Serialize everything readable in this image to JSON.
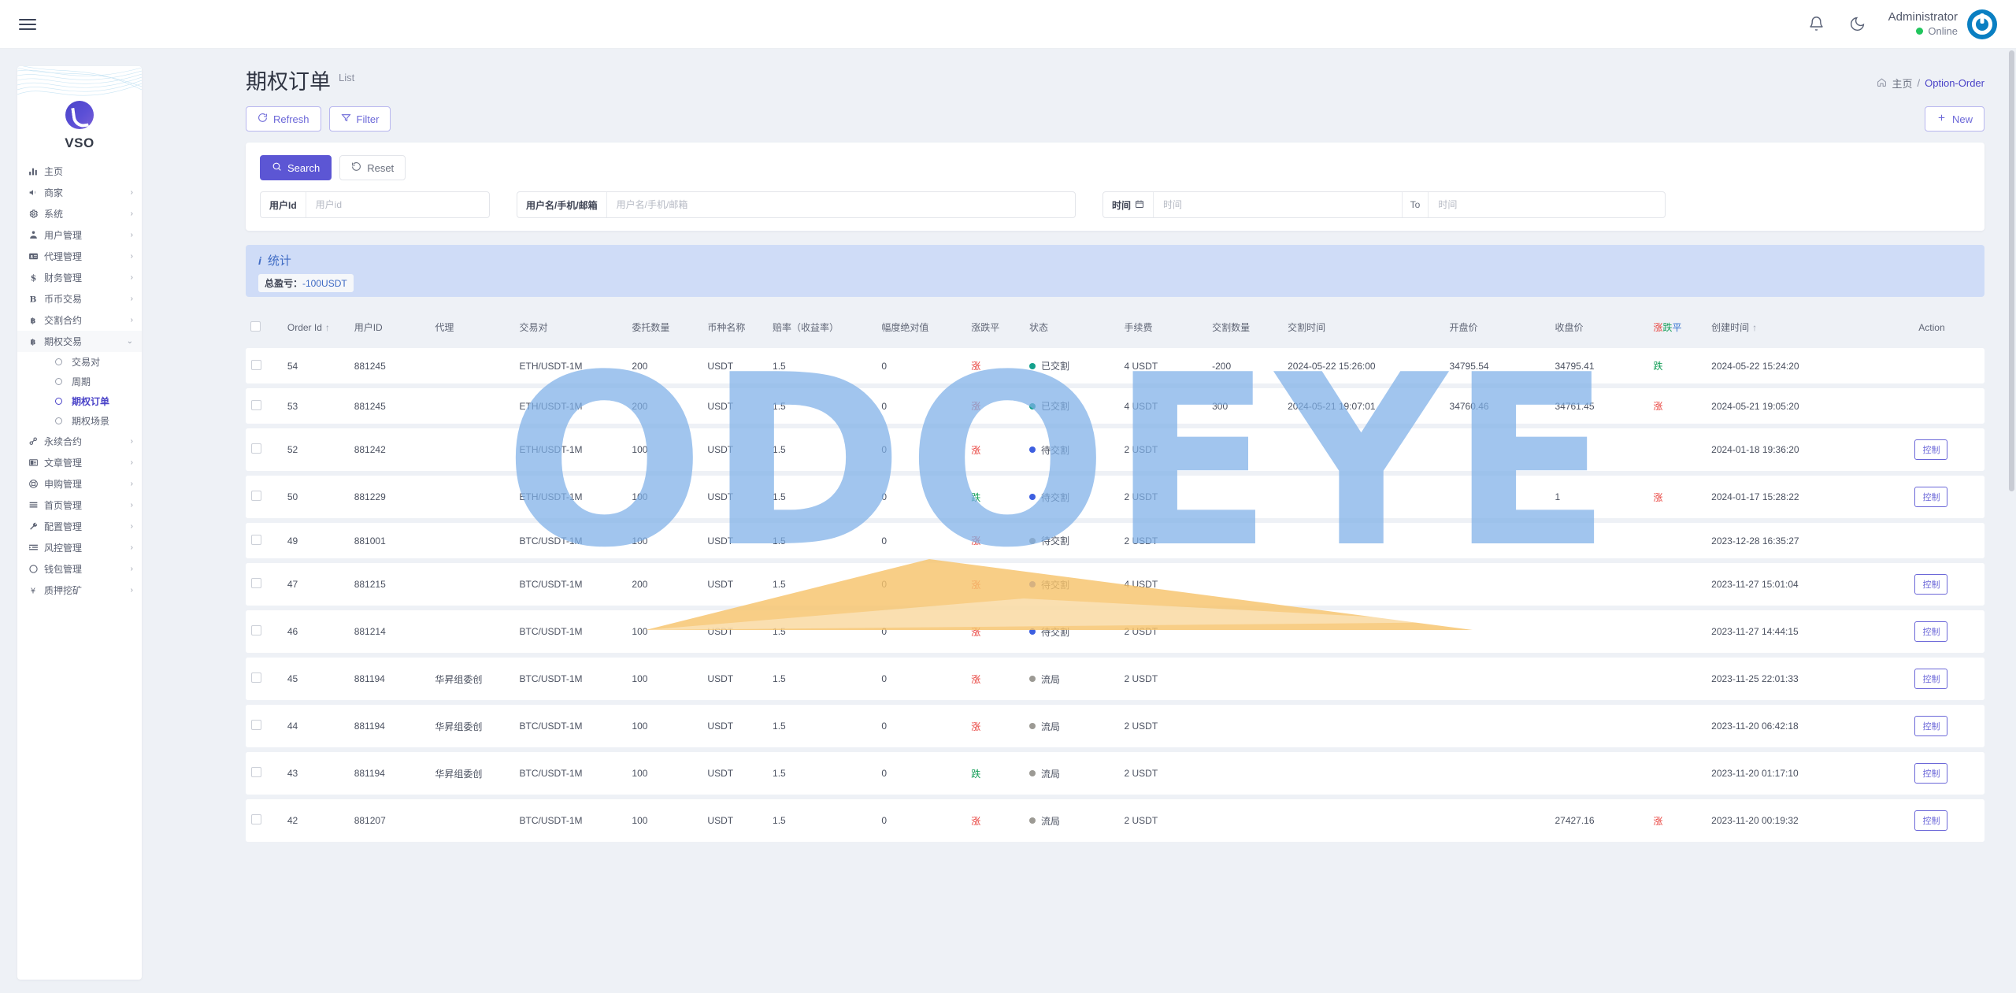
{
  "topbar": {
    "menu_icon": "hamburger-icon",
    "notification_icon": "bell-icon",
    "theme_icon": "moon-icon",
    "user_name": "Administrator",
    "user_status": "Online",
    "avatar_icon": "power-avatar-icon"
  },
  "sidebar": {
    "brand": "VSO",
    "items": [
      {
        "label": "主页",
        "icon": "chart-bars-icon",
        "caret": false
      },
      {
        "label": "商家",
        "icon": "megaphone-icon",
        "caret": true
      },
      {
        "label": "系统",
        "icon": "gear-icon",
        "caret": true
      },
      {
        "label": "用户管理",
        "icon": "user-manage-icon",
        "caret": true
      },
      {
        "label": "代理管理",
        "icon": "id-card-icon",
        "caret": true
      },
      {
        "label": "财务管理",
        "icon": "dollar-icon",
        "caret": true
      },
      {
        "label": "币币交易",
        "icon": "b-letter-icon",
        "caret": true
      },
      {
        "label": "交割合约",
        "icon": "bitcoin-icon",
        "caret": true
      },
      {
        "label": "期权交易",
        "icon": "bitcoin-icon",
        "caret": true,
        "open": true
      },
      {
        "label": "永续合约",
        "icon": "link-icon",
        "caret": true
      },
      {
        "label": "文章管理",
        "icon": "news-icon",
        "caret": true
      },
      {
        "label": "申购管理",
        "icon": "lifebuoy-icon",
        "caret": true
      },
      {
        "label": "首页管理",
        "icon": "lines-icon",
        "caret": true
      },
      {
        "label": "配置管理",
        "icon": "wrench-icon",
        "caret": true
      },
      {
        "label": "风控管理",
        "icon": "indent-icon",
        "caret": true
      },
      {
        "label": "钱包管理",
        "icon": "circle-icon",
        "caret": true
      },
      {
        "label": "质押挖矿",
        "icon": "yen-icon",
        "caret": true
      }
    ],
    "sub_items": [
      {
        "label": "交易对",
        "active": false
      },
      {
        "label": "周期",
        "active": false
      },
      {
        "label": "期权订单",
        "active": true
      },
      {
        "label": "期权场景",
        "active": false
      }
    ]
  },
  "page": {
    "title": "期权订单",
    "subtitle": "List",
    "breadcrumb_home": "主页",
    "breadcrumb_sep": "/",
    "breadcrumb_current": "Option-Order"
  },
  "toolbar": {
    "refresh_label": "Refresh",
    "filter_label": "Filter",
    "new_label": "New",
    "refresh_icon": "refresh-icon",
    "filter_icon": "funnel-icon",
    "new_icon": "plus-icon"
  },
  "search": {
    "search_label": "Search",
    "reset_label": "Reset",
    "search_icon": "search-icon",
    "reset_icon": "undo-icon",
    "userid_label": "用户Id",
    "userid_placeholder": "用户id",
    "userid_value": "",
    "username_label": "用户名/手机/邮箱",
    "username_placeholder": "用户名/手机/邮箱",
    "username_value": "",
    "time_label": "时间",
    "time_icon": "calendar-icon",
    "time_start_placeholder": "时间",
    "time_start_value": "",
    "time_to": "To",
    "time_end_placeholder": "时间",
    "time_end_value": ""
  },
  "stats": {
    "title": "统计",
    "info_icon": "info-icon",
    "chip_label": "总盈亏：",
    "chip_value": "-100USDT"
  },
  "table": {
    "headers": {
      "order_id": "Order Id",
      "user_id": "用户ID",
      "agent": "代理",
      "pair": "交易对",
      "amount": "委托数量",
      "coin": "币种名称",
      "rate": "赔率（收益率）",
      "abs": "幅度绝对值",
      "ud": "涨跌平",
      "status": "状态",
      "fee": "手续费",
      "deliver_qty": "交割数量",
      "deliver_time": "交割时间",
      "open_price": "开盘价",
      "close_price": "收盘价",
      "ud2_up": "涨",
      "ud2_down": "跌",
      "ud2_flat": "平",
      "create_time": "创建时间",
      "action": "Action",
      "sort_icon": "sort-asc-icon"
    },
    "rows": [
      {
        "id": "54",
        "user_id": "881245",
        "agent": "",
        "pair": "ETH/USDT-1M",
        "amount": "200",
        "coin": "USDT",
        "rate": "1.5",
        "abs": "0",
        "ud": "涨",
        "ud_dir": "up",
        "status": "已交割",
        "status_dot": "green",
        "fee": "4 USDT",
        "deliver_qty": "-200",
        "deliver_time": "2024-05-22 15:26:00",
        "open_price": "34795.54",
        "close_price": "34795.41",
        "ud2": "跌",
        "ud2_dir": "down",
        "create_time": "2024-05-22 15:24:20",
        "action": ""
      },
      {
        "id": "53",
        "user_id": "881245",
        "agent": "",
        "pair": "ETH/USDT-1M",
        "amount": "200",
        "coin": "USDT",
        "rate": "1.5",
        "abs": "0",
        "ud": "涨",
        "ud_dir": "up",
        "status": "已交割",
        "status_dot": "green",
        "fee": "4 USDT",
        "deliver_qty": "300",
        "deliver_time": "2024-05-21 19:07:01",
        "open_price": "34760.46",
        "close_price": "34761.45",
        "ud2": "涨",
        "ud2_dir": "up",
        "create_time": "2024-05-21 19:05:20",
        "action": ""
      },
      {
        "id": "52",
        "user_id": "881242",
        "agent": "",
        "pair": "ETH/USDT-1M",
        "amount": "100",
        "coin": "USDT",
        "rate": "1.5",
        "abs": "0",
        "ud": "涨",
        "ud_dir": "up",
        "status": "待交割",
        "status_dot": "blue",
        "fee": "2 USDT",
        "deliver_qty": "",
        "deliver_time": "",
        "open_price": "",
        "close_price": "",
        "ud2": "",
        "ud2_dir": "",
        "create_time": "2024-01-18 19:36:20",
        "action": "控制"
      },
      {
        "id": "50",
        "user_id": "881229",
        "agent": "",
        "pair": "ETH/USDT-1M",
        "amount": "100",
        "coin": "USDT",
        "rate": "1.5",
        "abs": "0",
        "ud": "跌",
        "ud_dir": "down",
        "status": "待交割",
        "status_dot": "blue",
        "fee": "2 USDT",
        "deliver_qty": "",
        "deliver_time": "",
        "open_price": "",
        "close_price": "1",
        "ud2": "涨",
        "ud2_dir": "up",
        "create_time": "2024-01-17 15:28:22",
        "action": "控制"
      },
      {
        "id": "49",
        "user_id": "881001",
        "agent": "",
        "pair": "BTC/USDT-1M",
        "amount": "100",
        "coin": "USDT",
        "rate": "1.5",
        "abs": "0",
        "ud": "涨",
        "ud_dir": "up",
        "status": "待交割",
        "status_dot": "dark",
        "fee": "2 USDT",
        "deliver_qty": "",
        "deliver_time": "",
        "open_price": "",
        "close_price": "",
        "ud2": "",
        "ud2_dir": "",
        "create_time": "2023-12-28 16:35:27",
        "action": ""
      },
      {
        "id": "47",
        "user_id": "881215",
        "agent": "",
        "pair": "BTC/USDT-1M",
        "amount": "200",
        "coin": "USDT",
        "rate": "1.5",
        "abs": "0",
        "ud": "涨",
        "ud_dir": "up",
        "status": "待交割",
        "status_dot": "blue",
        "fee": "4 USDT",
        "deliver_qty": "",
        "deliver_time": "",
        "open_price": "",
        "close_price": "",
        "ud2": "",
        "ud2_dir": "",
        "create_time": "2023-11-27 15:01:04",
        "action": "控制"
      },
      {
        "id": "46",
        "user_id": "881214",
        "agent": "",
        "pair": "BTC/USDT-1M",
        "amount": "100",
        "coin": "USDT",
        "rate": "1.5",
        "abs": "0",
        "ud": "涨",
        "ud_dir": "up",
        "status": "待交割",
        "status_dot": "blue",
        "fee": "2 USDT",
        "deliver_qty": "",
        "deliver_time": "",
        "open_price": "",
        "close_price": "",
        "ud2": "",
        "ud2_dir": "",
        "create_time": "2023-11-27 14:44:15",
        "action": "控制"
      },
      {
        "id": "45",
        "user_id": "881194",
        "agent": "华昇组委创",
        "pair": "BTC/USDT-1M",
        "amount": "100",
        "coin": "USDT",
        "rate": "1.5",
        "abs": "0",
        "ud": "涨",
        "ud_dir": "up",
        "status": "流局",
        "status_dot": "grey",
        "fee": "2 USDT",
        "deliver_qty": "",
        "deliver_time": "",
        "open_price": "",
        "close_price": "",
        "ud2": "",
        "ud2_dir": "",
        "create_time": "2023-11-25 22:01:33",
        "action": "控制"
      },
      {
        "id": "44",
        "user_id": "881194",
        "agent": "华昇组委创",
        "pair": "BTC/USDT-1M",
        "amount": "100",
        "coin": "USDT",
        "rate": "1.5",
        "abs": "0",
        "ud": "涨",
        "ud_dir": "up",
        "status": "流局",
        "status_dot": "grey",
        "fee": "2 USDT",
        "deliver_qty": "",
        "deliver_time": "",
        "open_price": "",
        "close_price": "",
        "ud2": "",
        "ud2_dir": "",
        "create_time": "2023-11-20 06:42:18",
        "action": "控制"
      },
      {
        "id": "43",
        "user_id": "881194",
        "agent": "华昇组委创",
        "pair": "BTC/USDT-1M",
        "amount": "100",
        "coin": "USDT",
        "rate": "1.5",
        "abs": "0",
        "ud": "跌",
        "ud_dir": "down",
        "status": "流局",
        "status_dot": "grey",
        "fee": "2 USDT",
        "deliver_qty": "",
        "deliver_time": "",
        "open_price": "",
        "close_price": "",
        "ud2": "",
        "ud2_dir": "",
        "create_time": "2023-11-20 01:17:10",
        "action": "控制"
      },
      {
        "id": "42",
        "user_id": "881207",
        "agent": "",
        "pair": "BTC/USDT-1M",
        "amount": "100",
        "coin": "USDT",
        "rate": "1.5",
        "abs": "0",
        "ud": "涨",
        "ud_dir": "up",
        "status": "流局",
        "status_dot": "grey",
        "fee": "2 USDT",
        "deliver_qty": "",
        "deliver_time": "",
        "open_price": "",
        "close_price": "27427.16",
        "ud2": "涨",
        "ud2_dir": "up",
        "create_time": "2023-11-20 00:19:32",
        "action": "控制"
      }
    ]
  },
  "watermark": {
    "text": "ODOEYE"
  },
  "colors": {
    "accent": "#5c56d4",
    "up": "#e8413c",
    "down": "#18a05a",
    "flat": "#2f6fd0",
    "banner": "#cfdcf7"
  }
}
